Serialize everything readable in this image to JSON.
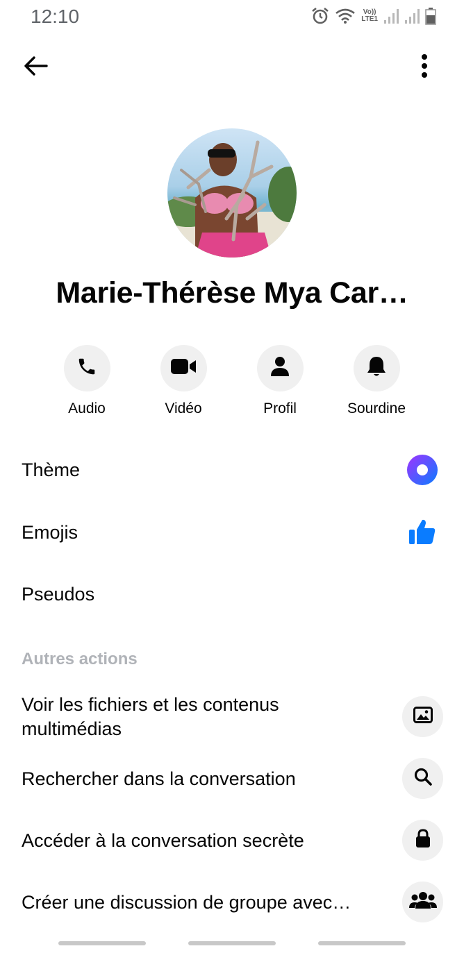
{
  "status_bar": {
    "time": "12:10",
    "icons": [
      "alarm-icon",
      "wifi-icon",
      "volte-icon",
      "signal-icon",
      "signal-icon",
      "battery-icon"
    ],
    "volte_top": "Vo))",
    "volte_bottom": "LTE1"
  },
  "top_bar": {
    "back_icon": "arrow-left-icon",
    "menu_icon": "more-vertical-icon"
  },
  "profile": {
    "name": "Marie-Thérèse Mya Car…"
  },
  "actions": [
    {
      "label": "Audio",
      "icon": "phone-icon"
    },
    {
      "label": "Vidéo",
      "icon": "video-camera-icon"
    },
    {
      "label": "Profil",
      "icon": "person-icon"
    },
    {
      "label": "Sourdine",
      "icon": "bell-icon"
    }
  ],
  "settings": [
    {
      "label": "Thème",
      "icon": "theme-dot-icon"
    },
    {
      "label": "Emojis",
      "icon": "thumbs-up-icon"
    },
    {
      "label": "Pseudos"
    }
  ],
  "other_actions": {
    "title": "Autres actions",
    "items": [
      {
        "label_line1": "Voir les fichiers et les contenus",
        "label_line2": "multimédias",
        "icon": "image-icon"
      },
      {
        "label": "Rechercher dans la conversation",
        "icon": "search-icon"
      },
      {
        "label": "Accéder à la conversation secrète",
        "icon": "lock-icon"
      },
      {
        "label": "Créer une discussion de groupe avec…",
        "icon": "group-icon"
      }
    ]
  },
  "colors": {
    "accent_blue": "#0a7cff",
    "theme_gradient_start": "#a033ff",
    "theme_gradient_end": "#0a7cff",
    "circle_bg": "#f0f0f0",
    "section_grey": "#b0b3b8"
  }
}
